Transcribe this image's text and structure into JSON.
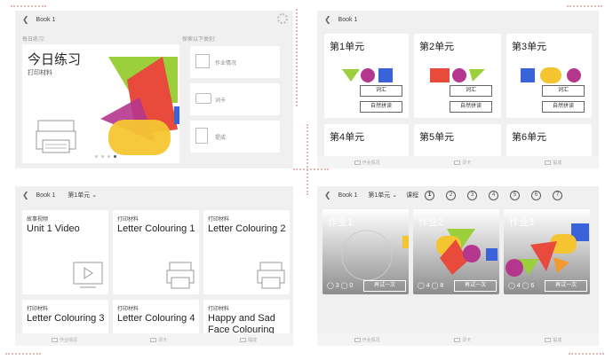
{
  "book_title": "Book 1",
  "top_left": {
    "section_label": "每日练习:",
    "explore_label": "探索以下类别:",
    "hero_title": "今日练习",
    "hero_subtitle": "打印材料",
    "categories": [
      "作业情况",
      "词卡",
      "提成"
    ]
  },
  "top_right": {
    "units": [
      {
        "title": "第1单元",
        "btn1": "词汇",
        "btn2": "自然拼读"
      },
      {
        "title": "第2单元",
        "btn1": "词汇",
        "btn2": "自然拼读"
      },
      {
        "title": "第3单元",
        "btn1": "词汇",
        "btn2": "自然拼读"
      },
      {
        "title": "第4单元"
      },
      {
        "title": "第5单元"
      },
      {
        "title": "第6单元"
      }
    ],
    "tabs": [
      "作业情况",
      "词卡",
      "提成"
    ]
  },
  "bottom_left": {
    "unit_dropdown": "第1单元",
    "cards": [
      {
        "category": "故事视频",
        "title": "Unit 1 Video"
      },
      {
        "category": "打印材料",
        "title": "Letter Colouring 1"
      },
      {
        "category": "打印材料",
        "title": "Letter Colouring 2"
      },
      {
        "category": "打印材料",
        "title": "Letter Colouring 3"
      },
      {
        "category": "打印材料",
        "title": "Letter Colouring 4"
      },
      {
        "category": "打印材料",
        "title": "Happy and Sad Face Colouring"
      }
    ],
    "tabs": [
      "作业情况",
      "词卡",
      "提成"
    ]
  },
  "bottom_right": {
    "unit_dropdown": "第1单元",
    "course_label": "课程",
    "lessons": [
      "1",
      "2",
      "3",
      "4",
      "5",
      "6",
      "7"
    ],
    "active_lesson": "1",
    "homework": [
      {
        "title": "作业1",
        "stat1": "3",
        "stat2": "0",
        "button": "再试一次"
      },
      {
        "title": "作业2",
        "stat1": "4",
        "stat2": "8",
        "button": "再试一次"
      },
      {
        "title": "作业3",
        "stat1": "4",
        "stat2": "6",
        "button": "再试一次"
      }
    ],
    "tabs": [
      "作业情况",
      "词卡",
      "提成"
    ]
  },
  "colors": {
    "red": "#e84b3c",
    "yellow": "#f5c531",
    "green": "#9bcf3b",
    "blue": "#3b63d9",
    "purple": "#b5368d",
    "orange": "#f29a2e"
  }
}
